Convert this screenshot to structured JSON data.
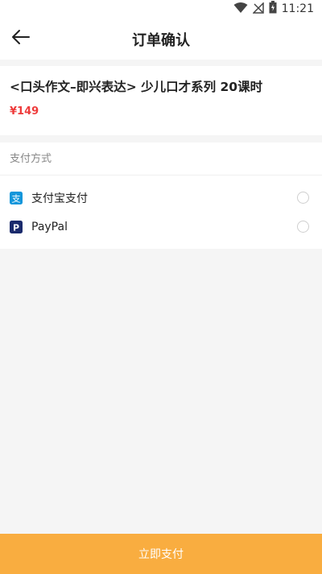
{
  "status_bar": {
    "time": "11:21",
    "icons": [
      "wifi-icon",
      "signal-off-icon",
      "battery-icon"
    ]
  },
  "header": {
    "title": "订单确认",
    "back_icon": "back-arrow-icon"
  },
  "product": {
    "title": "<口头作文–即兴表达> 少儿口才系列 20课时",
    "price": "¥149"
  },
  "payment": {
    "section_label": "支付方式",
    "options": [
      {
        "label": "支付宝支付",
        "icon": "alipay-icon",
        "icon_color": "#1296db",
        "selected": false
      },
      {
        "label": "PayPal",
        "icon": "paypal-icon",
        "icon_color": "#1a2a6c",
        "selected": false
      }
    ]
  },
  "footer": {
    "pay_button_label": "立即支付",
    "button_color": "#f9ad40"
  },
  "colors": {
    "accent": "#f9ad40",
    "price": "#ee3b3b",
    "background": "#f5f5f5"
  }
}
